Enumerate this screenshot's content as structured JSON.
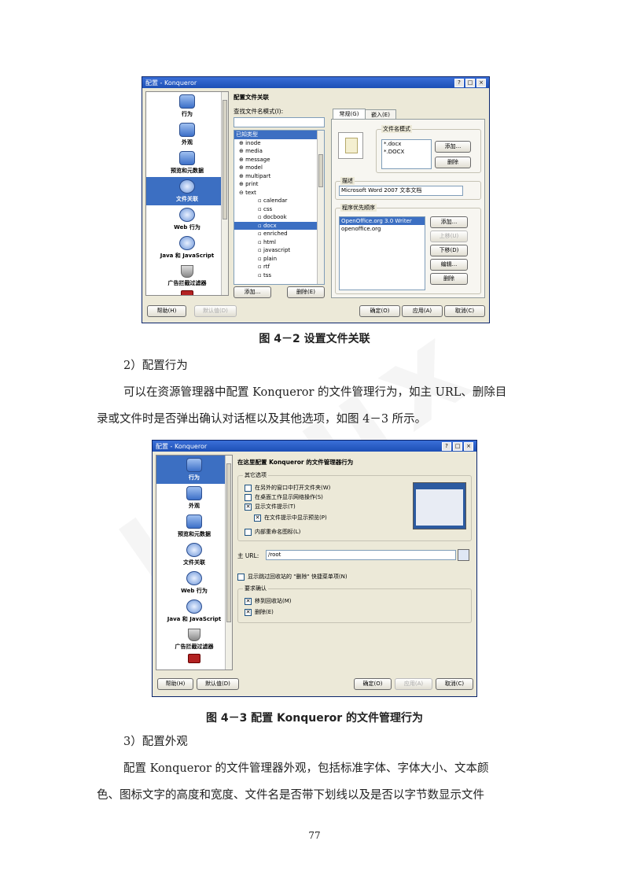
{
  "fig1": {
    "title": "配置 - Konqueror",
    "sidebar": [
      "行为",
      "外观",
      "预览和元数据",
      "文件关联",
      "Web 行为",
      "Java 和 JavaScript",
      "广告拦截过滤器"
    ],
    "header": "配置文件关联",
    "search_label": "查找文件名模式(I):",
    "tree_header": "已知类型",
    "tree": [
      "inode",
      "media",
      "message",
      "model",
      "multipart",
      "print",
      "text",
      "calendar",
      "css",
      "docbook",
      "docx",
      "enriched",
      "html",
      "javascript",
      "plain",
      "rtf",
      "tss",
      "..."
    ],
    "tabs": [
      "常规(G)",
      "嵌入(E)"
    ],
    "pattern_group": "文件名模式",
    "patterns": [
      "*.docx",
      "*.DOCX"
    ],
    "add": "添加...",
    "remove": "删除",
    "desc_group": "描述",
    "desc_value": "Microsoft Word 2007 文本文档",
    "app_group": "程序优先顺序",
    "apps": [
      "OpenOffice.org 3.0 Writer",
      "openoffice.org"
    ],
    "up": "上移(U)",
    "down": "下移(D)",
    "edit": "编辑...",
    "tree_add": "添加...",
    "tree_remove": "删除(E)",
    "help": "帮助(H)",
    "defaults": "默认值(D)",
    "ok": "确定(O)",
    "apply": "应用(A)",
    "cancel": "取消(C)"
  },
  "caption1": "图 4－2 设置文件关联",
  "heading2": "2）配置行为",
  "para2_line1": "可以在资源管理器中配置 Konqueror 的文件管理行为，如主 URL、删除目",
  "para2_line2": "录或文件时是否弹出确认对话框以及其他选项，如图 4－3 所示。",
  "fig2": {
    "title": "配置 - Konqueror",
    "header": "在这里配置 Konqueror 的文件管理器行为",
    "misc_group": "其它选项",
    "opt1": "在另外的窗口中打开文件夹(W)",
    "opt2": "在桌面工作显示网络操作(S)",
    "opt3": "显示文件提示(T)",
    "opt3a": "在文件提示中显示预览(P)",
    "opt4": "内部重命名图标(L)",
    "home_label": "主 URL:",
    "home_value": "/root",
    "trash_opt": "显示跳过回收站的 \"删除\" 快捷菜单项(N)",
    "confirm_group": "要求确认",
    "c1": "移到回收站(M)",
    "c2": "删除(E)"
  },
  "caption2": "图 4－3 配置 Konqueror 的文件管理行为",
  "heading3": "3）配置外观",
  "para3_line1": "配置 Konqueror 的文件管理器外观，包括标准字体、字体大小、文本颜",
  "para3_line2": "色、图标文字的高度和宽度、文件名是否带下划线以及是否以字节数显示文件",
  "page_number": "77"
}
